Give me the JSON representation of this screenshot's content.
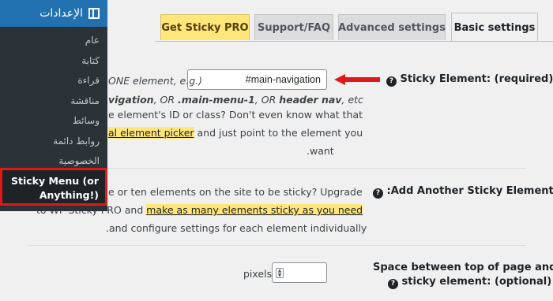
{
  "sidebar": {
    "header": "الإعدادات",
    "items": [
      "عام",
      "كتابة",
      "قراءة",
      "مناقشة",
      "وسائط",
      "روابط دائمة",
      "الخصوصية"
    ],
    "active_line1": "Sticky Menu (or",
    "active_line2": "Anything!)"
  },
  "tabs": {
    "pro": "Get Sticky PRO",
    "faq": "Support/FAQ",
    "advanced": "Advanced settings",
    "basic": "Basic settings"
  },
  "sticky_element": {
    "label": "Sticky Element: (required)",
    "input_value": "#main-navigation",
    "line1": "ONE element, e.g.)",
    "line2_a": "vigation",
    "line2_b": ", OR ",
    "line2_c": ".main-menu-1",
    "line2_d": ", OR ",
    "line2_e": "header nav",
    "line2_f": ", etc",
    "line3": "e element's ID or class? Don't even know what that",
    "line4_hl": "al element picker",
    "line4_rest": " and just point to the element you",
    "line5": ".want"
  },
  "add_another": {
    "label": ":Add Another Sticky Element",
    "line1": "e or ten elements on the site to be sticky? Upgrade",
    "line2_pre": "to WP Sticky PRO and ",
    "line2_hl": "make as many elements sticky as you need",
    "line3": ".and configure settings for each element individually"
  },
  "space": {
    "label_line1": "Space between top of page and",
    "label_line2": "sticky element: (optional)",
    "unit": "pixels"
  },
  "colors": {
    "admin_blue": "#2271b1",
    "sidebar_dark": "#2c3338",
    "highlight_yellow": "#ffe67a",
    "annotation_red": "#e01818"
  }
}
